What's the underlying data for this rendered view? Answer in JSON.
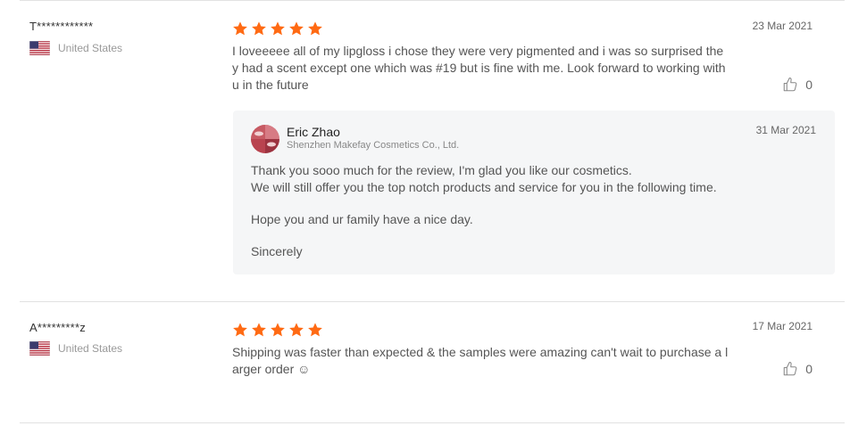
{
  "reviews": [
    {
      "user": "T************",
      "country": "United States",
      "date": "23 Mar 2021",
      "text": "I loveeeee all of my lipgloss i chose they were very pigmented and i was so surprised they had a scent except one which was #19 but is fine with me. Look forward to working with u in the future",
      "rating": 5,
      "helpful_count": "0",
      "reply": {
        "name": "Eric Zhao",
        "company": "Shenzhen Makefay Cosmetics Co., Ltd.",
        "date": "31 Mar 2021",
        "lines": [
          "Thank you sooo much for the review, I'm glad you like our cosmetics.",
          "We will still offer you the top notch products and service for you in the following time.",
          "Hope you and ur family have a nice day.",
          "Sincerely"
        ]
      }
    },
    {
      "user": "A*********z",
      "country": "United States",
      "date": "17 Mar 2021",
      "text": "Shipping was faster than expected & the samples were amazing can't wait to purchase a larger order ☺",
      "rating": 5,
      "helpful_count": "0"
    }
  ],
  "colors": {
    "star": "#ff6a13",
    "separator": "#e2e2e2",
    "reply_bg": "#f5f6f7"
  },
  "icons": {
    "rating": "star-icon",
    "helpful": "thumbs-up-icon",
    "country": "us-flag-icon"
  }
}
